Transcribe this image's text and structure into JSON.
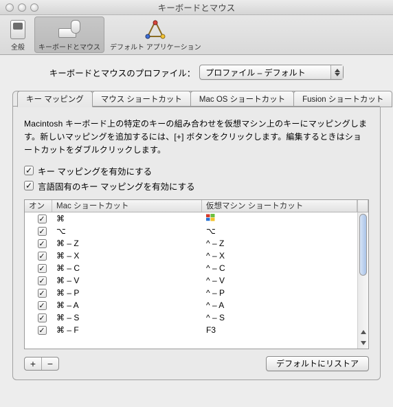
{
  "window": {
    "title": "キーボードとマウス"
  },
  "toolbar": {
    "items": [
      {
        "id": "general",
        "label": "全般"
      },
      {
        "id": "kbm",
        "label": "キーボードとマウス"
      },
      {
        "id": "defapp",
        "label": "デフォルト アプリケーション"
      }
    ]
  },
  "profile": {
    "label": "キーボードとマウスのプロファイル：",
    "selected": "プロファイル – デフォルト"
  },
  "tabs": [
    {
      "id": "keymap",
      "label": "キー マッピング"
    },
    {
      "id": "mouse",
      "label": "マウス ショートカット"
    },
    {
      "id": "macos",
      "label": "Mac OS ショートカット"
    },
    {
      "id": "fusion",
      "label": "Fusion ショートカット"
    }
  ],
  "description": "Macintosh キーボード上の特定のキーの組み合わせを仮想マシン上のキーにマッピングします。新しいマッピングを追加するには、[+] ボタンをクリックします。編集するときはショートカットをダブルクリックします。",
  "checkboxes": {
    "enable": "キー マッピングを有効にする",
    "language": "言語固有のキー マッピングを有効にする"
  },
  "table": {
    "headers": {
      "on": "オン",
      "mac": "Mac ショートカット",
      "vm": "仮想マシン ショートカット"
    },
    "rows": [
      {
        "on": true,
        "mac": "⌘",
        "vm_icon": "win",
        "vm": ""
      },
      {
        "on": true,
        "mac": "⌥",
        "vm": "⌥"
      },
      {
        "on": true,
        "mac": "⌘ – Z",
        "vm": "^ – Z"
      },
      {
        "on": true,
        "mac": "⌘ – X",
        "vm": "^ – X"
      },
      {
        "on": true,
        "mac": "⌘ – C",
        "vm": "^ – C"
      },
      {
        "on": true,
        "mac": "⌘ – V",
        "vm": "^ – V"
      },
      {
        "on": true,
        "mac": "⌘ – P",
        "vm": "^ – P"
      },
      {
        "on": true,
        "mac": "⌘ – A",
        "vm": "^ – A"
      },
      {
        "on": true,
        "mac": "⌘ – S",
        "vm": "^ – S"
      },
      {
        "on": true,
        "mac": "⌘ – F",
        "vm": "F3"
      }
    ]
  },
  "buttons": {
    "add": "+",
    "remove": "−",
    "restore": "デフォルトにリストア"
  }
}
